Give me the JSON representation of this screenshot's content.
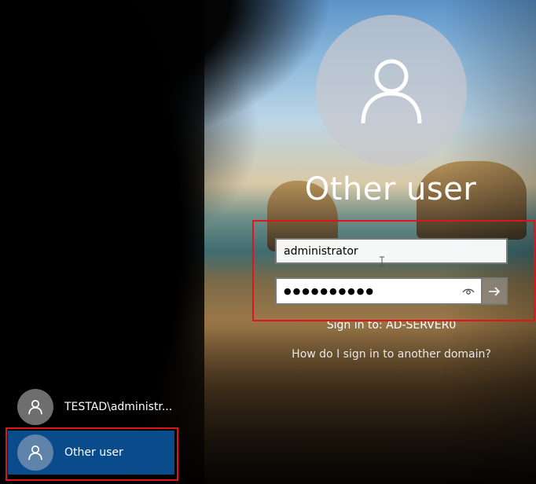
{
  "lock_screen": {
    "title": "Other user",
    "username_value": "administrator",
    "password_mask": "●●●●●●●●●●",
    "sign_in_to": "Sign in to: AD-SERVER0",
    "domain_help_link": "How do I sign in to another domain?"
  },
  "user_list": [
    {
      "label": "TESTAD\\administr...",
      "selected": false
    },
    {
      "label": "Other user",
      "selected": true
    }
  ],
  "icons": {
    "avatar": "user-silhouette-icon",
    "reveal": "eye-icon",
    "submit": "arrow-right-icon"
  },
  "colors": {
    "highlight_box": "#e0141b",
    "selected_tile": "#0a4b8c"
  }
}
